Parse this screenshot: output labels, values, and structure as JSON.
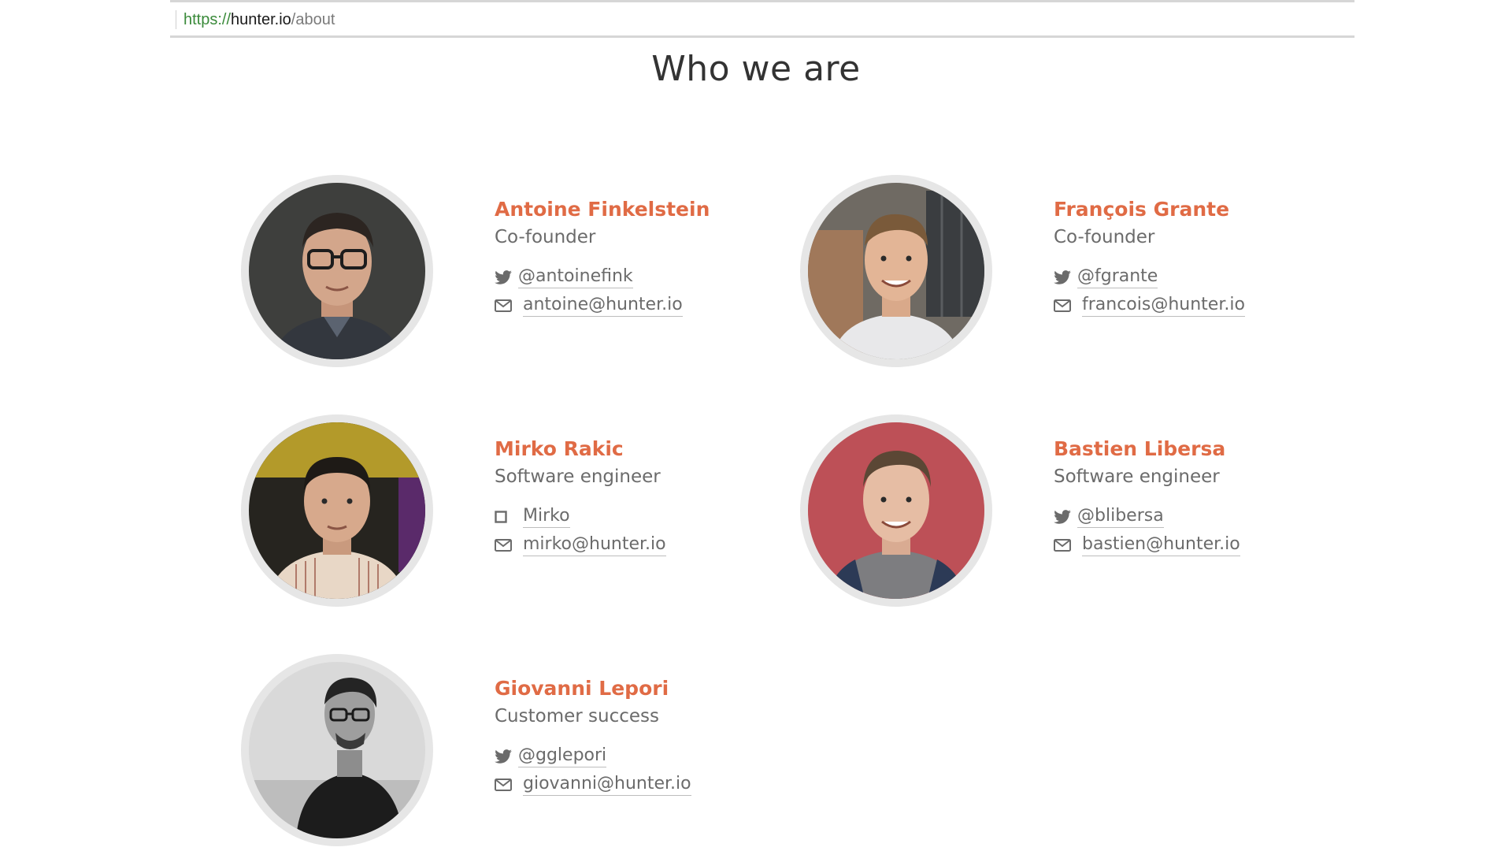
{
  "browser": {
    "url_scheme": "https://",
    "url_host": "hunter.io",
    "url_path": "/about"
  },
  "page": {
    "title": "Who we are"
  },
  "members": [
    {
      "name": "Antoine Finkelstein",
      "role": "Co-founder",
      "twitter": "@antoinefink",
      "email": "antoine@hunter.io",
      "first_contact_icon": "twitter-icon"
    },
    {
      "name": "François Grante",
      "role": "Co-founder",
      "twitter": "@fgrante",
      "email": "francois@hunter.io",
      "first_contact_icon": "twitter-icon"
    },
    {
      "name": "Mirko Rakic",
      "role": "Software engineer",
      "twitter": "Mirko",
      "email": "mirko@hunter.io",
      "first_contact_icon": "square-icon"
    },
    {
      "name": "Bastien Libersa",
      "role": "Software engineer",
      "twitter": "@blibersa",
      "email": "bastien@hunter.io",
      "first_contact_icon": "twitter-icon"
    },
    {
      "name": "Giovanni Lepori",
      "role": "Customer success",
      "twitter": "@gglepori",
      "email": "giovanni@hunter.io",
      "first_contact_icon": "twitter-icon"
    }
  ],
  "colors": {
    "name_accent": "#e06b45",
    "text_muted": "#6b6b6b",
    "avatar_ring": "#e6e6e6"
  }
}
